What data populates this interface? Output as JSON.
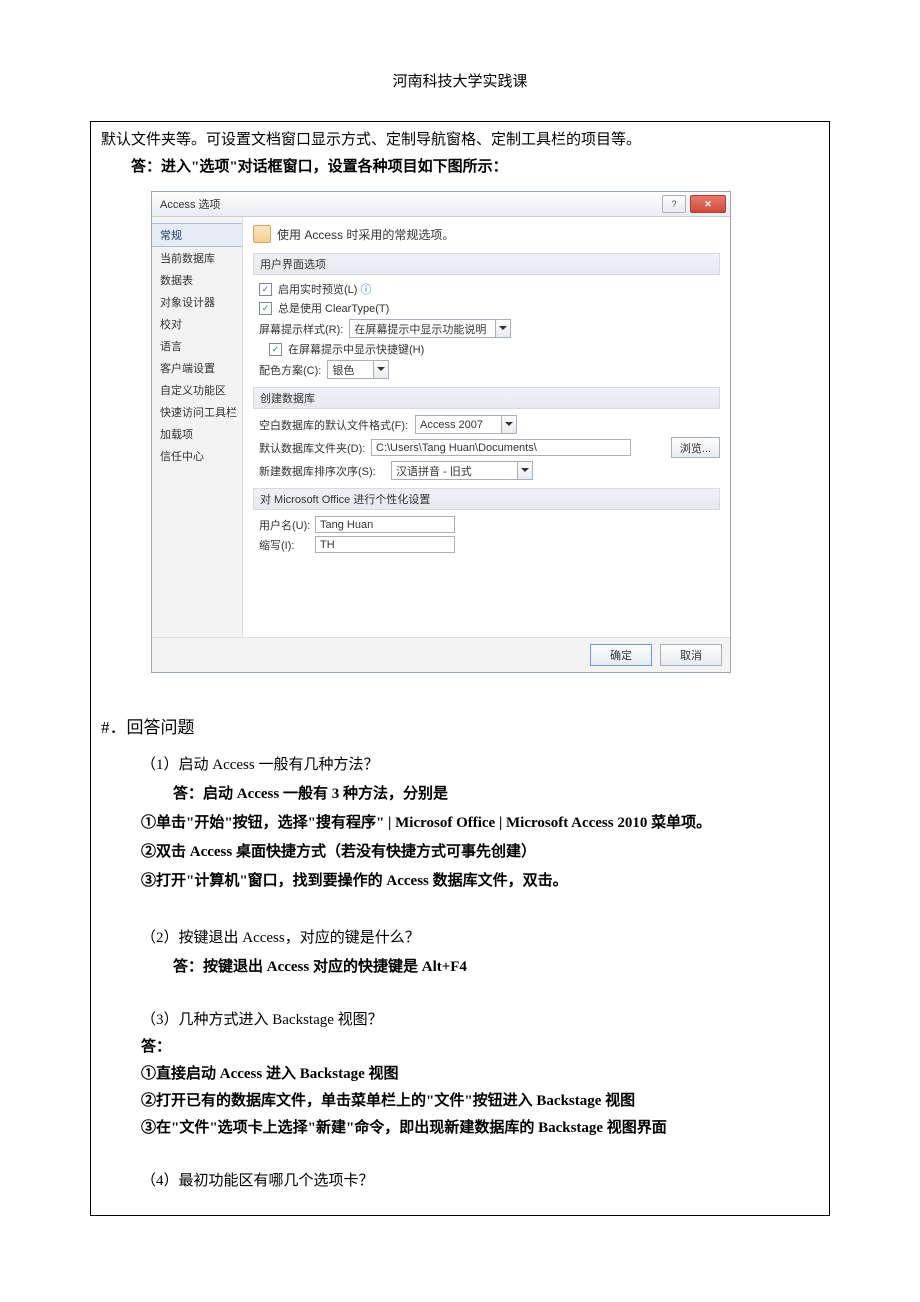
{
  "header": {
    "title": "河南科技大学实践课"
  },
  "intro": {
    "line1": "默认文件夹等。可设置文档窗口显示方式、定制导航窗格、定制工具栏的项目等。",
    "line2": "答：进入\"选项\"对话框窗口，设置各种项目如下图所示："
  },
  "dialog": {
    "title": "Access 选项",
    "sidebar": [
      "常规",
      "当前数据库",
      "数据表",
      "对象设计器",
      "校对",
      "语言",
      "客户端设置",
      "自定义功能区",
      "快速访问工具栏",
      "加载项",
      "信任中心"
    ],
    "head": "使用 Access 时采用的常规选项。",
    "sec1": "用户界面选项",
    "chk1": "启用实时预览(L)",
    "chk2": "总是使用 ClearType(T)",
    "tipStyleLabel": "屏幕提示样式(R):",
    "tipStyleValue": "在屏幕提示中显示功能说明",
    "chk3": "在屏幕提示中显示快捷键(H)",
    "colorLabel": "配色方案(C):",
    "colorValue": "银色",
    "sec2": "创建数据库",
    "fmtLabel": "空白数据库的默认文件格式(F):",
    "fmtValue": "Access 2007",
    "folderLabel": "默认数据库文件夹(D):",
    "folderValue": "C:\\Users\\Tang Huan\\Documents\\",
    "browse": "浏览...",
    "sortLabel": "新建数据库排序次序(S):",
    "sortValue": "汉语拼音 - 旧式",
    "sec3": "对 Microsoft Office 进行个性化设置",
    "userLabel": "用户名(U):",
    "userValue": "Tang Huan",
    "initLabel": "缩写(I):",
    "initValue": "TH",
    "ok": "确定",
    "cancel": "取消"
  },
  "section": {
    "heading": "#．回答问题"
  },
  "qa": {
    "q1": "（1）启动 Access 一般有几种方法？",
    "a1": "答：启动 Access 一般有 3 种方法，分别是",
    "a1_1": "①单击\"开始\"按钮，选择\"搜有程序\" | Microsof Office | Microsoft Access 2010  菜单项。",
    "a1_2": "②双击  Access  桌面快捷方式（若没有快捷方式可事先创建）",
    "a1_3": "③打开\"计算机\"窗口，找到要操作的  Access  数据库文件，双击。",
    "q2": "（2）按键退出 Access，对应的键是什么？",
    "a2": "答：按键退出 Access 对应的快捷键是 Alt+F4",
    "q3": "（3）几种方式进入 Backstage 视图？",
    "a3": "答：",
    "a3_1": "①直接启动 Access 进入 Backstage 视图",
    "a3_2": "②打开已有的数据库文件，单击菜单栏上的\"文件\"按钮进入 Backstage 视图",
    "a3_3": "③在\"文件\"选项卡上选择\"新建\"命令，即出现新建数据库的 Backstage 视图界面",
    "q4": "（4）最初功能区有哪几个选项卡？"
  }
}
